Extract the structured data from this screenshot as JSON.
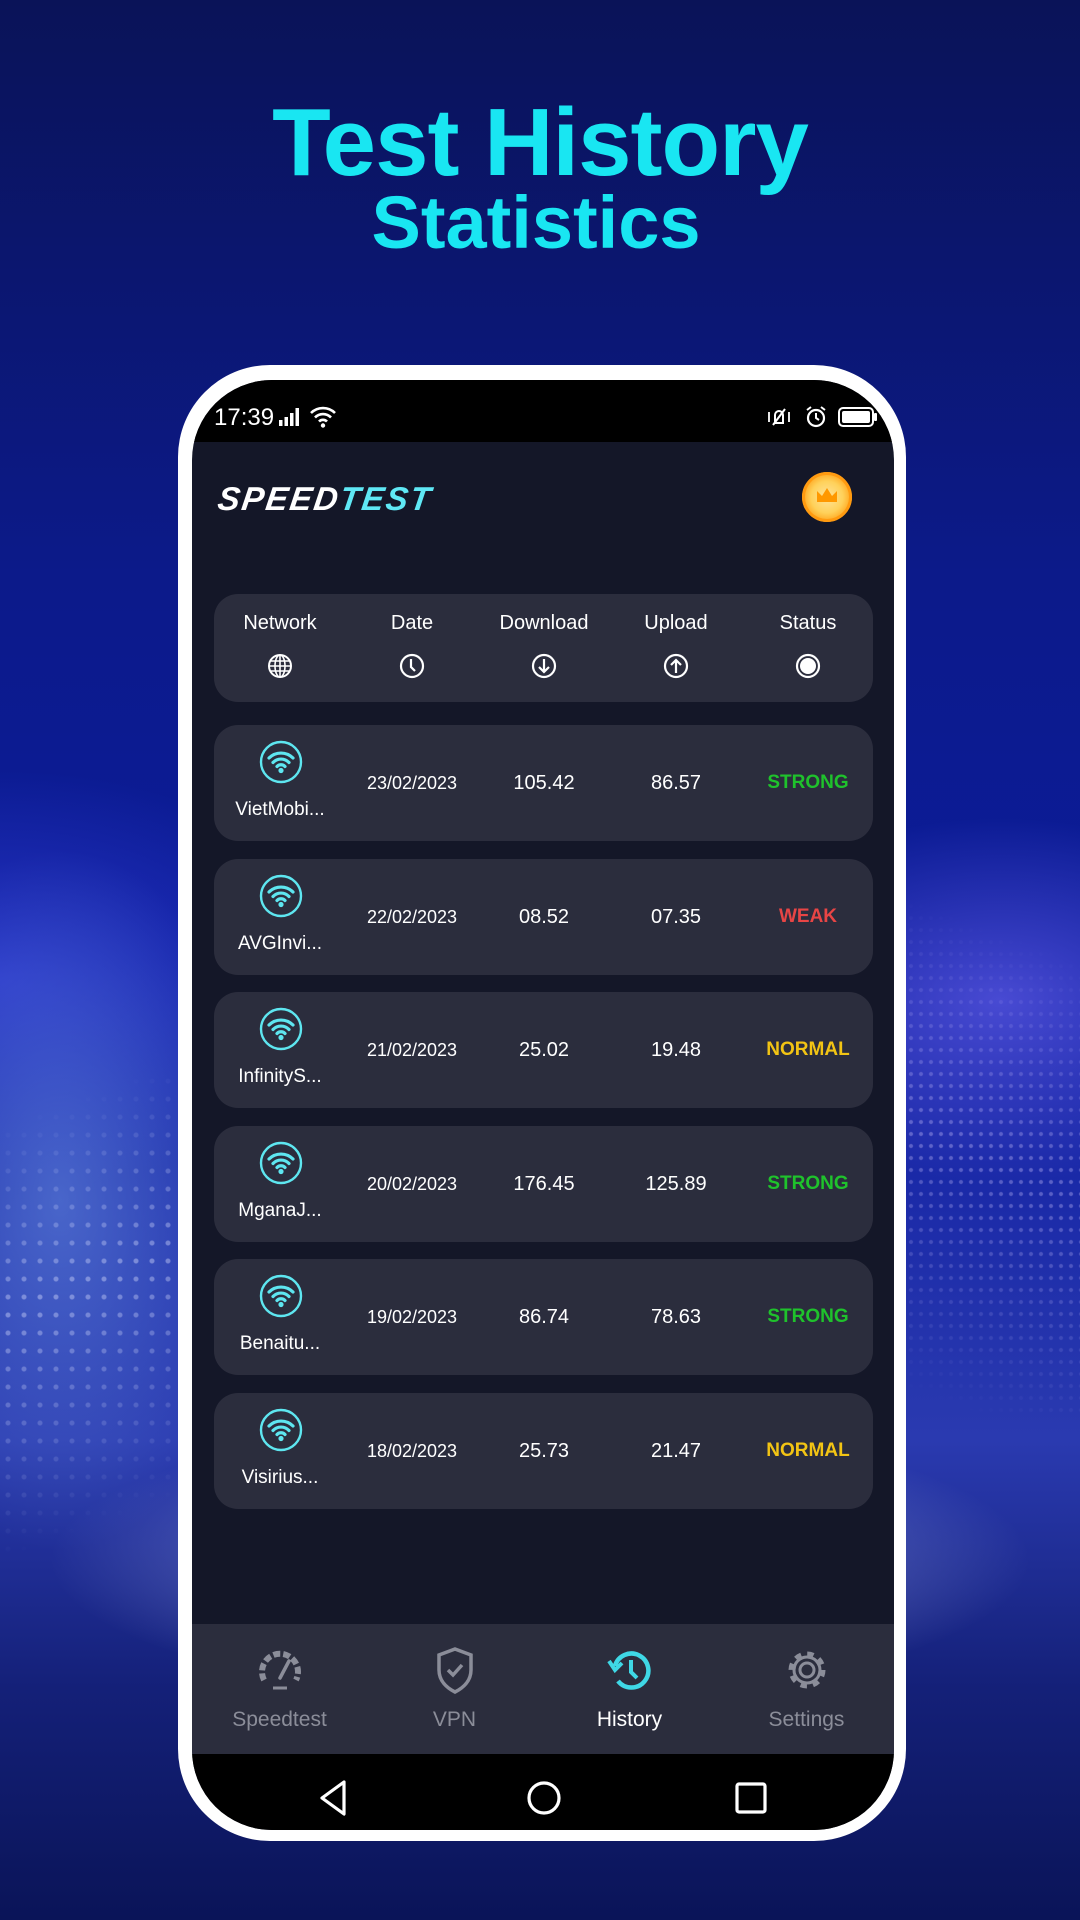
{
  "promo": {
    "headline_line1": "Test History",
    "headline_line2": "Statistics",
    "headline_color": "#19e6f2"
  },
  "status_bar": {
    "time": "17:39",
    "icons": [
      "signal-icon",
      "wifi-icon",
      "vibrate-icon",
      "alarm-icon",
      "battery-icon"
    ]
  },
  "app_bar": {
    "logo_part1": "SPEED",
    "logo_part2": "TEST",
    "premium_icon": "crown-icon"
  },
  "table": {
    "columns": [
      {
        "label": "Network",
        "icon": "globe-icon"
      },
      {
        "label": "Date",
        "icon": "clock-icon"
      },
      {
        "label": "Download",
        "icon": "download-icon"
      },
      {
        "label": "Upload",
        "icon": "upload-icon"
      },
      {
        "label": "Status",
        "icon": "status-dot-icon"
      }
    ],
    "rows": [
      {
        "network": "VietMobi...",
        "date": "23/02/2023",
        "download": "105.42",
        "upload": "86.57",
        "status": "STRONG"
      },
      {
        "network": "AVGInvi...",
        "date": "22/02/2023",
        "download": "08.52",
        "upload": "07.35",
        "status": "WEAK"
      },
      {
        "network": "InfinityS...",
        "date": "21/02/2023",
        "download": "25.02",
        "upload": "19.48",
        "status": "NORMAL"
      },
      {
        "network": "MganaJ...",
        "date": "20/02/2023",
        "download": "176.45",
        "upload": "125.89",
        "status": "STRONG"
      },
      {
        "network": "Benaitu...",
        "date": "19/02/2023",
        "download": "86.74",
        "upload": "78.63",
        "status": "STRONG"
      },
      {
        "network": "Visirius...",
        "date": "18/02/2023",
        "download": "25.73",
        "upload": "21.47",
        "status": "NORMAL"
      }
    ],
    "status_colors": {
      "STRONG": "#1fc22c",
      "WEAK": "#e84545",
      "NORMAL": "#f2c414"
    }
  },
  "bottom_nav": {
    "items": [
      {
        "label": "Speedtest",
        "icon": "speedometer-icon",
        "active": false
      },
      {
        "label": "VPN",
        "icon": "shield-check-icon",
        "active": false
      },
      {
        "label": "History",
        "icon": "history-icon",
        "active": true
      },
      {
        "label": "Settings",
        "icon": "gear-icon",
        "active": false
      }
    ],
    "active_color": "#3fd8e6",
    "inactive_color": "#8b8d99"
  },
  "system_nav": {
    "buttons": [
      "back-icon",
      "home-icon",
      "recents-icon"
    ]
  }
}
